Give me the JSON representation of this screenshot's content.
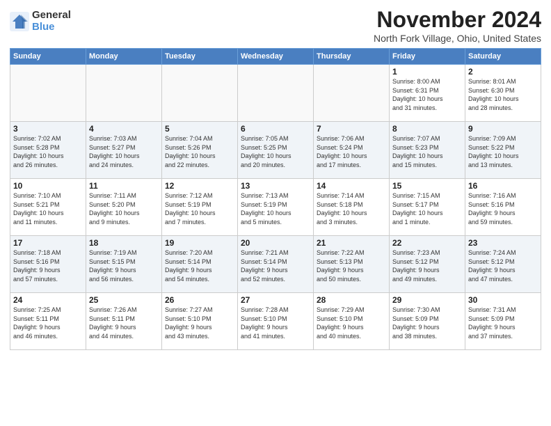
{
  "logo": {
    "general": "General",
    "blue": "Blue"
  },
  "title": "November 2024",
  "location": "North Fork Village, Ohio, United States",
  "days_of_week": [
    "Sunday",
    "Monday",
    "Tuesday",
    "Wednesday",
    "Thursday",
    "Friday",
    "Saturday"
  ],
  "weeks": [
    [
      {
        "day": "",
        "info": ""
      },
      {
        "day": "",
        "info": ""
      },
      {
        "day": "",
        "info": ""
      },
      {
        "day": "",
        "info": ""
      },
      {
        "day": "",
        "info": ""
      },
      {
        "day": "1",
        "info": "Sunrise: 8:00 AM\nSunset: 6:31 PM\nDaylight: 10 hours\nand 31 minutes."
      },
      {
        "day": "2",
        "info": "Sunrise: 8:01 AM\nSunset: 6:30 PM\nDaylight: 10 hours\nand 28 minutes."
      }
    ],
    [
      {
        "day": "3",
        "info": "Sunrise: 7:02 AM\nSunset: 5:28 PM\nDaylight: 10 hours\nand 26 minutes."
      },
      {
        "day": "4",
        "info": "Sunrise: 7:03 AM\nSunset: 5:27 PM\nDaylight: 10 hours\nand 24 minutes."
      },
      {
        "day": "5",
        "info": "Sunrise: 7:04 AM\nSunset: 5:26 PM\nDaylight: 10 hours\nand 22 minutes."
      },
      {
        "day": "6",
        "info": "Sunrise: 7:05 AM\nSunset: 5:25 PM\nDaylight: 10 hours\nand 20 minutes."
      },
      {
        "day": "7",
        "info": "Sunrise: 7:06 AM\nSunset: 5:24 PM\nDaylight: 10 hours\nand 17 minutes."
      },
      {
        "day": "8",
        "info": "Sunrise: 7:07 AM\nSunset: 5:23 PM\nDaylight: 10 hours\nand 15 minutes."
      },
      {
        "day": "9",
        "info": "Sunrise: 7:09 AM\nSunset: 5:22 PM\nDaylight: 10 hours\nand 13 minutes."
      }
    ],
    [
      {
        "day": "10",
        "info": "Sunrise: 7:10 AM\nSunset: 5:21 PM\nDaylight: 10 hours\nand 11 minutes."
      },
      {
        "day": "11",
        "info": "Sunrise: 7:11 AM\nSunset: 5:20 PM\nDaylight: 10 hours\nand 9 minutes."
      },
      {
        "day": "12",
        "info": "Sunrise: 7:12 AM\nSunset: 5:19 PM\nDaylight: 10 hours\nand 7 minutes."
      },
      {
        "day": "13",
        "info": "Sunrise: 7:13 AM\nSunset: 5:19 PM\nDaylight: 10 hours\nand 5 minutes."
      },
      {
        "day": "14",
        "info": "Sunrise: 7:14 AM\nSunset: 5:18 PM\nDaylight: 10 hours\nand 3 minutes."
      },
      {
        "day": "15",
        "info": "Sunrise: 7:15 AM\nSunset: 5:17 PM\nDaylight: 10 hours\nand 1 minute."
      },
      {
        "day": "16",
        "info": "Sunrise: 7:16 AM\nSunset: 5:16 PM\nDaylight: 9 hours\nand 59 minutes."
      }
    ],
    [
      {
        "day": "17",
        "info": "Sunrise: 7:18 AM\nSunset: 5:16 PM\nDaylight: 9 hours\nand 57 minutes."
      },
      {
        "day": "18",
        "info": "Sunrise: 7:19 AM\nSunset: 5:15 PM\nDaylight: 9 hours\nand 56 minutes."
      },
      {
        "day": "19",
        "info": "Sunrise: 7:20 AM\nSunset: 5:14 PM\nDaylight: 9 hours\nand 54 minutes."
      },
      {
        "day": "20",
        "info": "Sunrise: 7:21 AM\nSunset: 5:14 PM\nDaylight: 9 hours\nand 52 minutes."
      },
      {
        "day": "21",
        "info": "Sunrise: 7:22 AM\nSunset: 5:13 PM\nDaylight: 9 hours\nand 50 minutes."
      },
      {
        "day": "22",
        "info": "Sunrise: 7:23 AM\nSunset: 5:12 PM\nDaylight: 9 hours\nand 49 minutes."
      },
      {
        "day": "23",
        "info": "Sunrise: 7:24 AM\nSunset: 5:12 PM\nDaylight: 9 hours\nand 47 minutes."
      }
    ],
    [
      {
        "day": "24",
        "info": "Sunrise: 7:25 AM\nSunset: 5:11 PM\nDaylight: 9 hours\nand 46 minutes."
      },
      {
        "day": "25",
        "info": "Sunrise: 7:26 AM\nSunset: 5:11 PM\nDaylight: 9 hours\nand 44 minutes."
      },
      {
        "day": "26",
        "info": "Sunrise: 7:27 AM\nSunset: 5:10 PM\nDaylight: 9 hours\nand 43 minutes."
      },
      {
        "day": "27",
        "info": "Sunrise: 7:28 AM\nSunset: 5:10 PM\nDaylight: 9 hours\nand 41 minutes."
      },
      {
        "day": "28",
        "info": "Sunrise: 7:29 AM\nSunset: 5:10 PM\nDaylight: 9 hours\nand 40 minutes."
      },
      {
        "day": "29",
        "info": "Sunrise: 7:30 AM\nSunset: 5:09 PM\nDaylight: 9 hours\nand 38 minutes."
      },
      {
        "day": "30",
        "info": "Sunrise: 7:31 AM\nSunset: 5:09 PM\nDaylight: 9 hours\nand 37 minutes."
      }
    ]
  ]
}
